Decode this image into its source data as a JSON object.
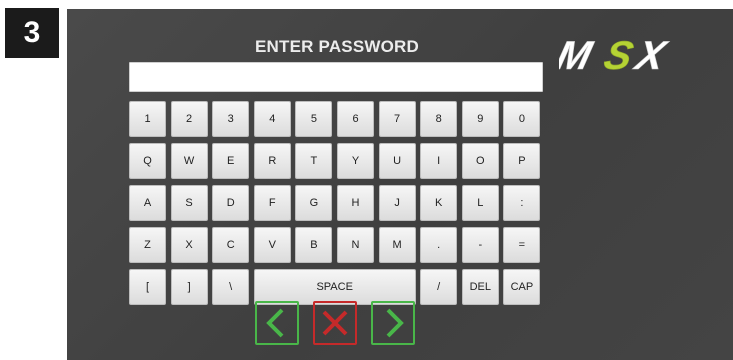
{
  "step_badge": "3",
  "screen": {
    "title": "ENTER PASSWORD",
    "logo_text": "MSX",
    "password_value": ""
  },
  "keyboard": {
    "rows": [
      [
        "1",
        "2",
        "3",
        "4",
        "5",
        "6",
        "7",
        "8",
        "9",
        "0"
      ],
      [
        "Q",
        "W",
        "E",
        "R",
        "T",
        "Y",
        "U",
        "I",
        "O",
        "P"
      ],
      [
        "A",
        "S",
        "D",
        "F",
        "G",
        "H",
        "J",
        "K",
        "L",
        ":"
      ],
      [
        "Z",
        "X",
        "C",
        "V",
        "B",
        "N",
        "M",
        ".",
        "-",
        "="
      ],
      [
        "[",
        "]",
        "\\",
        "SPACE",
        "/",
        "DEL",
        "CAP"
      ]
    ]
  },
  "nav": {
    "back_icon": "chevron-left-icon",
    "cancel_icon": "x-icon",
    "next_icon": "chevron-right-icon"
  },
  "colors": {
    "screen_bg": "#454545",
    "key_face": "#e8e8e8",
    "nav_green": "#49b649",
    "nav_red": "#c52a2a",
    "logo_green": "#b5d334"
  }
}
